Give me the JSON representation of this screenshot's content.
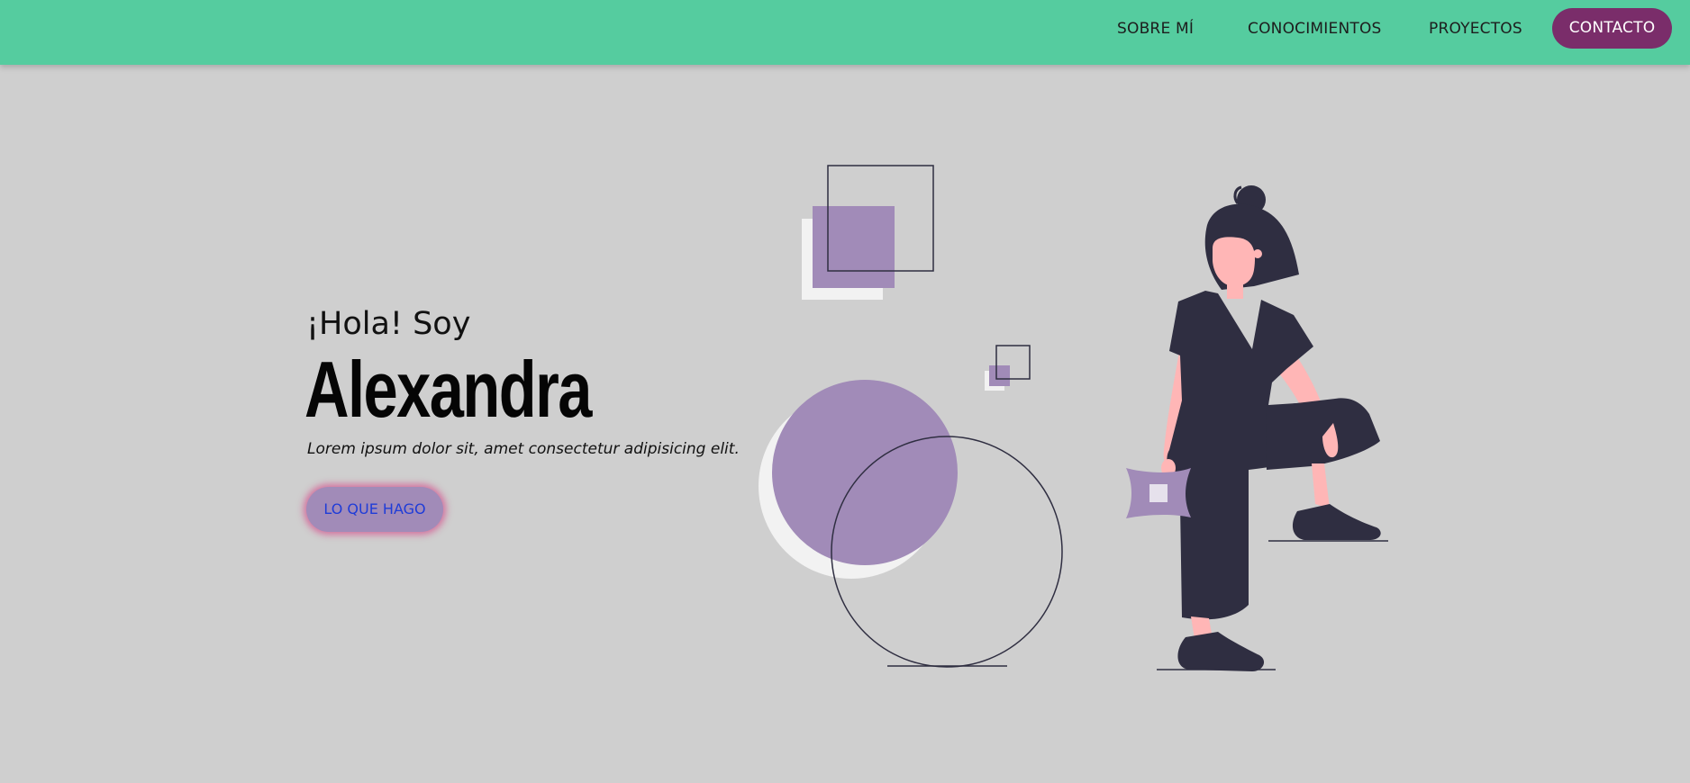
{
  "nav": {
    "about_label": "SOBRE MÍ",
    "skills_label": "CONOCIMIENTOS",
    "projects_label": "PROYECTOS",
    "contact_label": "CONTACTO"
  },
  "hero": {
    "greeting": "¡Hola! Soy",
    "name": "Alexandra",
    "subtitle": "Lorem ipsum dolor sit, amet consectetur adipisicing elit.",
    "cta_label": "LO QUE HAGO"
  },
  "colors": {
    "navbar": "#55cc9f",
    "background": "#cfcfcf",
    "contact_button": "#7a2d6a",
    "accent_purple": "#a18bb8",
    "ink": "#2f2e41",
    "skin": "#ffb6b6"
  }
}
